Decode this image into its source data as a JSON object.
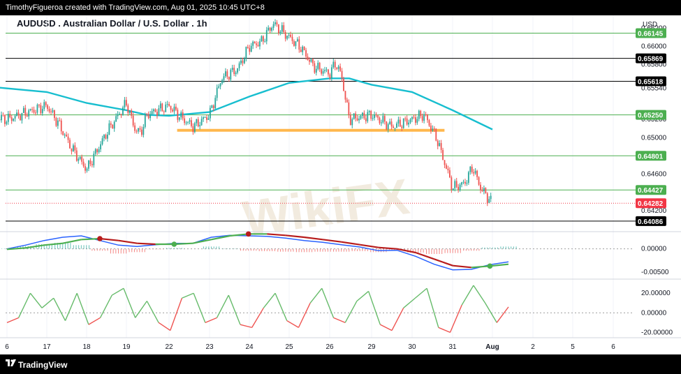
{
  "header": {
    "attribution": "TimothyFigueroa created with TradingView.com, Aug 01, 2025 10:45 UTC+8"
  },
  "footer": {
    "brand": "TradingView",
    "logo_icon": "tradingview-logo-icon"
  },
  "watermark": "WikiFX",
  "colors": {
    "bull": "#26a69a",
    "bear": "#ef5350",
    "ma": "#17becf",
    "level_green": "#4caf50",
    "level_black": "#000000",
    "support_orange": "#ffb74d",
    "current_price": "#f23645",
    "macd_line": "#2962ff",
    "signal_line_up": "#4caf50",
    "signal_line_down": "#b71c1c",
    "osc_up": "#66bb6a",
    "osc_down": "#ef5350"
  },
  "chart_data": [
    {
      "type": "candlestick",
      "title": "AUDUSD . Australian Dollar / U.S. Dollar . 1h",
      "currency": "USD",
      "x_ticks": [
        "6",
        "17",
        "18",
        "19",
        "22",
        "23",
        "24",
        "25",
        "26",
        "29",
        "30",
        "31",
        "Aug",
        "2",
        "5",
        "6"
      ],
      "y_ticks": [
        "0.66200",
        "0.66000",
        "0.65800",
        "0.65540",
        "0.65200",
        "0.65000",
        "0.64600",
        "0.64200"
      ],
      "ylim": [
        0.6397,
        0.6634
      ],
      "price_path": [
        {
          "d": "16",
          "p": 0.653
        },
        {
          "d": "16.5",
          "p": 0.652
        },
        {
          "d": "17",
          "p": 0.6535
        },
        {
          "d": "17.3",
          "p": 0.6515
        },
        {
          "d": "17.6",
          "p": 0.649
        },
        {
          "d": "18",
          "p": 0.6465
        },
        {
          "d": "18.5",
          "p": 0.6505
        },
        {
          "d": "18.8",
          "p": 0.6525
        },
        {
          "d": "19",
          "p": 0.6538
        },
        {
          "d": "19.4",
          "p": 0.651
        },
        {
          "d": "19.7",
          "p": 0.6505
        },
        {
          "d": "20",
          "p": 0.6525
        },
        {
          "d": "22",
          "p": 0.6535
        },
        {
          "d": "22.3",
          "p": 0.6522
        },
        {
          "d": "22.6",
          "p": 0.6512
        },
        {
          "d": "23",
          "p": 0.6525
        },
        {
          "d": "23.3",
          "p": 0.6565
        },
        {
          "d": "23.7",
          "p": 0.6575
        },
        {
          "d": "24",
          "p": 0.66
        },
        {
          "d": "24.3",
          "p": 0.6605
        },
        {
          "d": "24.6",
          "p": 0.6625
        },
        {
          "d": "25",
          "p": 0.661
        },
        {
          "d": "25.3",
          "p": 0.6598
        },
        {
          "d": "25.6",
          "p": 0.6578
        },
        {
          "d": "26",
          "p": 0.657
        },
        {
          "d": "26.3",
          "p": 0.6582
        },
        {
          "d": "26.6",
          "p": 0.6568
        },
        {
          "d": "27",
          "p": 0.652
        },
        {
          "d": "29",
          "p": 0.6525
        },
        {
          "d": "29.5",
          "p": 0.6512
        },
        {
          "d": "30",
          "p": 0.652
        },
        {
          "d": "30.3",
          "p": 0.6525
        },
        {
          "d": "30.6",
          "p": 0.65
        },
        {
          "d": "31",
          "p": 0.6445
        },
        {
          "d": "31.3",
          "p": 0.645
        },
        {
          "d": "31.5",
          "p": 0.6468
        },
        {
          "d": "31.7",
          "p": 0.6445
        },
        {
          "d": "Aug 1",
          "p": 0.6428
        }
      ],
      "levels": [
        {
          "label": "0.66145",
          "style": "green"
        },
        {
          "label": "0.65869",
          "style": "black"
        },
        {
          "label": "0.65618",
          "style": "black"
        },
        {
          "label": "0.65250",
          "style": "green"
        },
        {
          "label": "0.64801",
          "style": "green"
        },
        {
          "label": "0.64427",
          "style": "green"
        },
        {
          "label": "0.64282",
          "style": "current"
        },
        {
          "label": "0.64086",
          "style": "black"
        }
      ],
      "support_zone": {
        "price": 0.6508,
        "from": "22.2",
        "to": "30.8"
      },
      "moving_average": [
        {
          "d": "16",
          "p": 0.6558
        },
        {
          "d": "17",
          "p": 0.655
        },
        {
          "d": "18",
          "p": 0.6538
        },
        {
          "d": "19",
          "p": 0.653
        },
        {
          "d": "20",
          "p": 0.6525
        },
        {
          "d": "22",
          "p": 0.6524
        },
        {
          "d": "23",
          "p": 0.6528
        },
        {
          "d": "24",
          "p": 0.6545
        },
        {
          "d": "25",
          "p": 0.656
        },
        {
          "d": "26",
          "p": 0.6565
        },
        {
          "d": "27",
          "p": 0.6565
        },
        {
          "d": "29",
          "p": 0.6558
        },
        {
          "d": "30",
          "p": 0.655
        },
        {
          "d": "31",
          "p": 0.653
        },
        {
          "d": "Aug 1",
          "p": 0.6509
        }
      ]
    },
    {
      "type": "line",
      "y_ticks": [
        "0.00000",
        "-0.00500"
      ],
      "ylim": [
        -0.0062,
        0.0034
      ],
      "zero": "0.00000",
      "macd": [
        0.0,
        0.0008,
        0.0018,
        0.0025,
        0.0028,
        0.0018,
        0.0008,
        0.0005,
        0.0009,
        0.0012,
        0.0012,
        0.0025,
        0.0029,
        0.0028,
        0.0027,
        0.0023,
        0.0018,
        0.0014,
        0.0009,
        0.0004,
        -0.0004,
        -0.0003,
        -0.0016,
        -0.0033,
        -0.0045,
        -0.0044,
        -0.0034,
        -0.0028
      ],
      "signal": [
        -0.0001,
        0.0002,
        0.0008,
        0.0012,
        0.002,
        0.0022,
        0.0018,
        0.0012,
        0.001,
        0.001,
        0.0012,
        0.002,
        0.0028,
        0.0032,
        0.0032,
        0.0029,
        0.0025,
        0.002,
        0.0015,
        0.0009,
        0.0003,
        0.0,
        -0.0008,
        -0.0022,
        -0.0036,
        -0.004,
        -0.0037,
        -0.0033
      ],
      "histogram": [
        0.0001,
        0.0006,
        0.001,
        0.0013,
        0.0008,
        -0.0004,
        -0.001,
        -0.0007,
        -0.0001,
        0.0002,
        0.0,
        0.0005,
        0.0001,
        -0.0004,
        -0.0005,
        -0.0006,
        -0.0007,
        -0.0006,
        -0.0006,
        -0.0005,
        -0.0007,
        -0.0003,
        -0.0008,
        -0.0011,
        -0.0009,
        -0.0004,
        0.0003,
        0.0005
      ]
    },
    {
      "type": "line",
      "y_ticks": [
        "20.00000",
        "0.00000",
        "-20.00000"
      ],
      "ylim": [
        -24,
        33
      ],
      "values": [
        -10,
        -5,
        20,
        5,
        15,
        -8,
        20,
        -12,
        -5,
        18,
        25,
        -5,
        12,
        -10,
        -18,
        15,
        20,
        -10,
        -5,
        18,
        -12,
        -15,
        5,
        20,
        -8,
        -15,
        10,
        25,
        -5,
        -10,
        12,
        22,
        -12,
        -18,
        5,
        15,
        25,
        -15,
        -20,
        8,
        28,
        10,
        -10,
        6
      ]
    }
  ]
}
